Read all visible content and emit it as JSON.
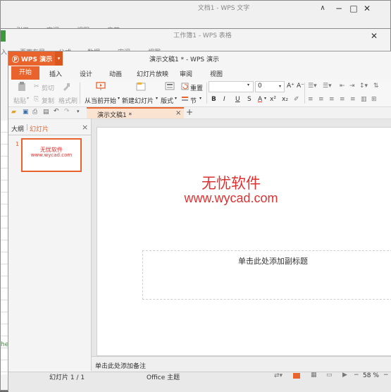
{
  "writer": {
    "title": "文档1 - WPS 文字",
    "tabs": [
      "引用",
      "审阅",
      "视图",
      "章节"
    ],
    "controls": [
      "∧",
      "−",
      "□",
      "✕"
    ]
  },
  "sheet": {
    "title": "工作簿1 - WPS 表格",
    "tabs": [
      "入",
      "页面布局",
      "公式",
      "数据",
      "审阅",
      "视图"
    ],
    "close": "✕",
    "bottom_text": "hee"
  },
  "app": {
    "logo": "WPS 演示",
    "title": "演示文稿1 * - WPS 演示",
    "menu": [
      "开始",
      "插入",
      "设计",
      "动画",
      "幻灯片放映",
      "审阅",
      "视图"
    ],
    "active_menu": "开始"
  },
  "toolbar": {
    "paste": "粘贴",
    "cut": "剪切",
    "copy": "复制",
    "format_painter": "格式刷",
    "from_current": "从当前开始",
    "new_slide": "新建幻灯片",
    "layout": "版式",
    "reset": "重置",
    "section": "节",
    "font_size": "0",
    "bold": "B",
    "italic": "I",
    "underline": "U",
    "strike": "S",
    "font_color": "A",
    "superscript": "x²",
    "subscript": "x₂",
    "grow": "A⁺",
    "shrink": "A⁻"
  },
  "doc_tab": {
    "name": "演示文稿1 *",
    "close": "×",
    "add": "+"
  },
  "panel": {
    "tab_outline": "大纲",
    "tab_slides": "幻灯片",
    "close": "×",
    "slide_number": "1",
    "thumb_line1": "无忧软件",
    "thumb_line2": "www.wycad.com"
  },
  "slide": {
    "title_line1": "无忧软件",
    "title_line2": "www.wycad.com",
    "subtitle_placeholder": "单击此处添加副标题"
  },
  "notes": {
    "placeholder": "单击此处添加备注"
  },
  "status": {
    "slide_indicator": "幻灯片 1 / 1",
    "theme": "Office 主题",
    "zoom": "58 %"
  },
  "colors": {
    "accent": "#e8642c",
    "slide_text": "#e03030"
  }
}
